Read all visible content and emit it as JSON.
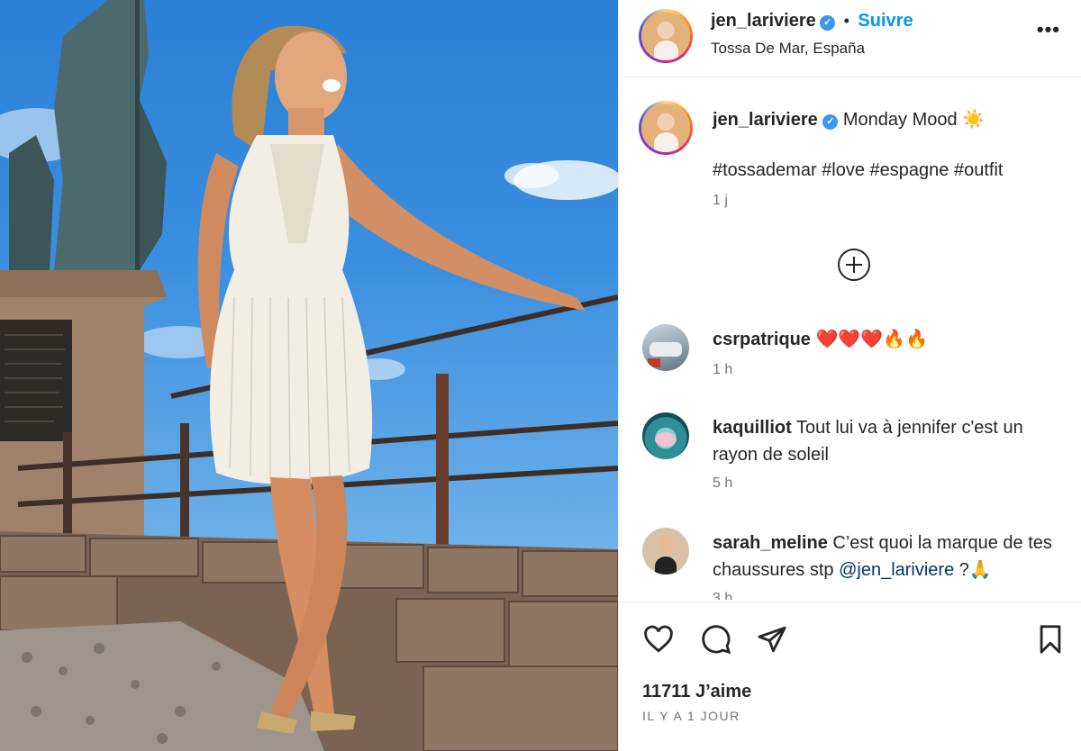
{
  "post": {
    "username": "jen_lariviere",
    "verified": true,
    "follow_label": "Suivre",
    "location": "Tossa De Mar, España",
    "more_label": "•••",
    "caption_text": "Monday Mood ☀️",
    "hashtags": "#tossademar #love #espagne #outfit",
    "caption_time": "1 j"
  },
  "comments": [
    {
      "username": "csrpatrique",
      "text": "❤️❤️❤️🔥🔥",
      "time": "1 h"
    },
    {
      "username": "kaquilliot",
      "text": "Tout lui va à jennifer c'est un rayon de soleil",
      "time": "5 h"
    },
    {
      "username": "sarah_meline",
      "text": "C’est quoi la marque de tes chaussures stp",
      "mention": "@jen_lariviere",
      "text_end": " ?🙏",
      "time": "3 h"
    }
  ],
  "footer": {
    "likes": "11711 J’aime",
    "posted": "IL Y A 1 JOUR"
  },
  "colors": {
    "accent": "#0095f6",
    "hashtag": "#00376b",
    "muted": "#737373",
    "verified": "#3897f0"
  },
  "icons": [
    "verified-icon",
    "more-icon",
    "load-more-icon",
    "heart-icon",
    "comment-icon",
    "share-icon",
    "bookmark-icon"
  ]
}
